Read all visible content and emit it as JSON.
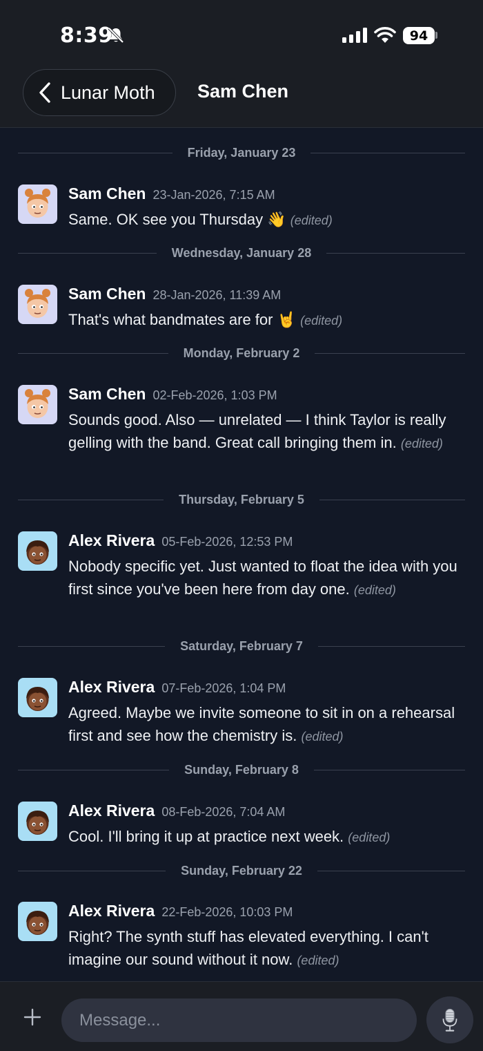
{
  "status_bar": {
    "time": "8:39",
    "battery": "94"
  },
  "header": {
    "back_label": "Lunar Moth",
    "title": "Sam Chen"
  },
  "messages": [
    {
      "date": "Friday, January 23",
      "author": "Sam Chen",
      "timestamp": "23-Jan-2026, 7:15 AM",
      "text": "Same. OK see you Thursday 👋",
      "edited": "(edited)"
    },
    {
      "date": "Wednesday, January 28",
      "author": "Sam Chen",
      "timestamp": "28-Jan-2026, 11:39 AM",
      "text": "That's what bandmates are for 🤘",
      "edited": "(edited)"
    },
    {
      "date": "Monday, February 2",
      "author": "Sam Chen",
      "timestamp": "02-Feb-2026, 1:03 PM",
      "text": "Sounds good. Also — unrelated — I think Taylor is really gelling with the band. Great call bringing them in.",
      "edited": "(edited)"
    },
    {
      "date": "Thursday, February 5",
      "author": "Alex Rivera",
      "timestamp": "05-Feb-2026, 12:53 PM",
      "text": "Nobody specific yet. Just wanted to float the idea with you first since you've been here from day one.",
      "edited": "(edited)"
    },
    {
      "date": "Saturday, February 7",
      "author": "Alex Rivera",
      "timestamp": "07-Feb-2026, 1:04 PM",
      "text": "Agreed. Maybe we invite someone to sit in on a rehearsal first and see how the chemistry is.",
      "edited": "(edited)"
    },
    {
      "date": "Sunday, February 8",
      "author": "Alex Rivera",
      "timestamp": "08-Feb-2026, 7:04 AM",
      "text": "Cool. I'll bring it up at practice next week.",
      "edited": "(edited)"
    },
    {
      "date": "Sunday, February 22",
      "author": "Alex Rivera",
      "timestamp": "22-Feb-2026, 10:03 PM",
      "text": "Right? The synth stuff has elevated everything. I can't imagine our sound without it now.",
      "edited": "(edited)"
    }
  ],
  "composer": {
    "placeholder": "Message..."
  },
  "icons": {
    "back": "chevron-left-icon",
    "mute": "bell-slash-icon",
    "add": "plus-icon",
    "mic": "microphone-icon"
  },
  "colors": {
    "background": "#121826",
    "header": "#1b1e24",
    "avatar_sam": "#d6d8f5",
    "avatar_alex": "#a9def5"
  }
}
